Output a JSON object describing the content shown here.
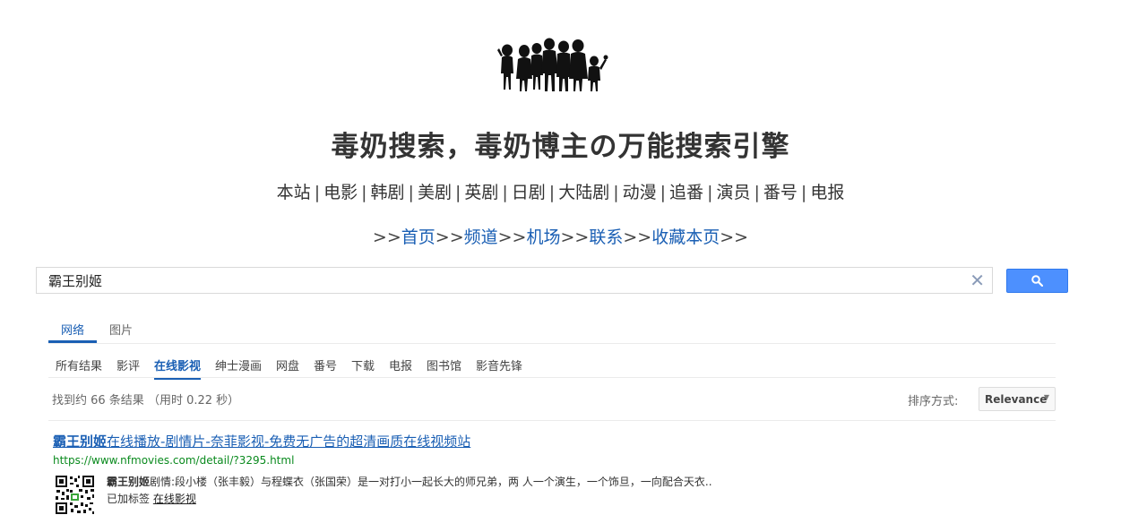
{
  "site": {
    "title": "毒奶搜索，毒奶博主の万能搜索引擎"
  },
  "category_nav": [
    "本站",
    "电影",
    "韩剧",
    "美剧",
    "英剧",
    "日剧",
    "大陆剧",
    "动漫",
    "追番",
    "演员",
    "番号",
    "电报"
  ],
  "link_nav": {
    "prefix": ">>",
    "items": [
      "首页",
      "频道",
      "机场",
      "联系",
      "收藏本页"
    ],
    "suffix": ">>"
  },
  "search": {
    "value": "霸王别姬",
    "clear_icon": "✕",
    "button_icon": "search-icon"
  },
  "tabs": [
    "网络",
    "图片"
  ],
  "active_tab": 0,
  "refinements": [
    "所有结果",
    "影评",
    "在线影视",
    "绅士漫画",
    "网盘",
    "番号",
    "下载",
    "电报",
    "图书馆",
    "影音先锋"
  ],
  "active_refinement": 2,
  "results_info": "找到约 66 条结果 （用时 0.22 秒）",
  "sort": {
    "label": "排序方式:",
    "value": "Relevance"
  },
  "results": [
    {
      "title_highlight": "霸王别姬",
      "title_rest": "在线播放-剧情片-奈菲影视-免费无广告的超清画质在线视频站",
      "url": "https://www.nfmovies.com/detail/?3295.html",
      "snippet_highlight": "霸王别姬",
      "snippet_rest": "剧情:段小楼（张丰毅）与程蝶衣（张国荣）是一对打小一起长大的师兄弟，两 人一个演生，一个饰旦，一向配合天衣..",
      "label_prefix": "已加标签",
      "label_link": "在线影视"
    }
  ],
  "colors": {
    "link": "#1a5fb4",
    "url": "#0a8a1e",
    "button": "#4d90fe"
  }
}
